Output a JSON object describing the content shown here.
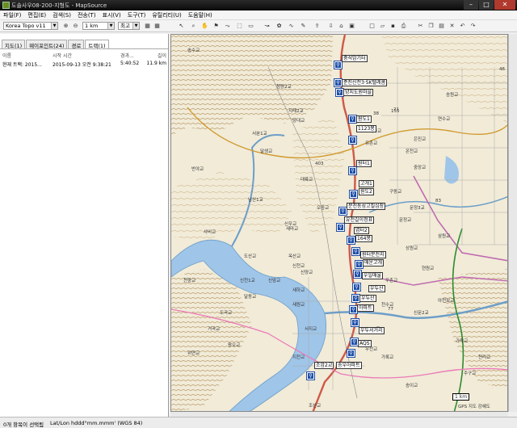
{
  "window": {
    "title": "도솔사우08-200-지형도 - MapSource"
  },
  "menu": [
    "파일(F)",
    "편집(E)",
    "검색(S)",
    "전송(T)",
    "표시(V)",
    "도구(T)",
    "유틸리티(U)",
    "도움말(H)"
  ],
  "toolbar": {
    "product": "Korea Topo v11",
    "zoom": "1 km",
    "detail": "최고"
  },
  "tabs": [
    "지도(1)",
    "웨이포인트(24)",
    "경로",
    "트랙(1)"
  ],
  "list": {
    "headers": [
      "이름",
      "시작 시간",
      "경과...",
      "길이"
    ],
    "rows": [
      [
        "현재 트랙: 2015...",
        "2015-09-13 오전 9:38:21",
        "5:40:52",
        "11.9 km"
      ]
    ]
  },
  "map": {
    "places": [
      "송수교",
      "청량2교",
      "지례2교",
      "당대교",
      "서분1교",
      "반야교",
      "달생교",
      "남산1교",
      "대륙교",
      "신우교",
      "사비교",
      "오중교",
      "도산교",
      "새마교",
      "신암교",
      "새하교",
      "천중교",
      "신양교",
      "달동교",
      "도곡교",
      "거곡교",
      "옥산교",
      "신천교",
      "신천1교",
      "위연교",
      "왕오교",
      "새원교",
      "서지교",
      "지천교",
      "가록교",
      "아천보교",
      "조산교",
      "신문2교",
      "우천교",
      "2교",
      "문정3교",
      "문정교",
      "중앙교",
      "우촌교",
      "삼원교",
      "유촌교",
      "은진교",
      "새마교",
      "상원교",
      "현원교",
      "천수교",
      "구동교",
      "연수교",
      "온천교",
      "주구교",
      "송이교",
      "천리교",
      "가락교",
      "송원교"
    ],
    "numbers": [
      "403",
      "46",
      "83",
      "77",
      "21",
      "155",
      "38"
    ],
    "waypoints": [
      "중석암기터",
      "준진신전3·SK텔레콤",
      "양지도원마을",
      "원도1",
      "1123봉",
      "원터1",
      "고개1",
      "원도2",
      "분천동성고질심장",
      "유천길이정표",
      "염터2",
      "164봉",
      "원터분천지",
      "매운고개",
      "우일매울",
      "우두산",
      "우두산",
      "아파트",
      "우두서거리",
      "AQS",
      "조암2교",
      "송우아파트"
    ]
  },
  "scale": "1 km",
  "attribution": "GPS 지도 강혜도",
  "status": {
    "selection": "0개 항목이 선택됨",
    "coords": "Lat/Lon hddd°mm.mmm' (WGS 84)"
  }
}
